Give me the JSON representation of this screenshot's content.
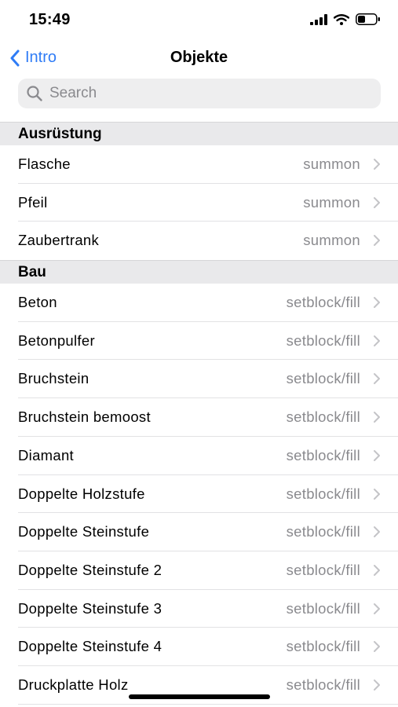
{
  "status_bar": {
    "time": "15:49"
  },
  "nav": {
    "back_label": "Intro",
    "title": "Objekte"
  },
  "search": {
    "placeholder": "Search"
  },
  "sections": [
    {
      "header": "Ausrüstung",
      "rows": [
        {
          "title": "Flasche",
          "detail": "summon"
        },
        {
          "title": "Pfeil",
          "detail": "summon"
        },
        {
          "title": "Zaubertrank",
          "detail": "summon"
        }
      ]
    },
    {
      "header": "Bau",
      "rows": [
        {
          "title": "Beton",
          "detail": "setblock/fill"
        },
        {
          "title": "Betonpulfer",
          "detail": "setblock/fill"
        },
        {
          "title": "Bruchstein",
          "detail": "setblock/fill"
        },
        {
          "title": "Bruchstein bemoost",
          "detail": "setblock/fill"
        },
        {
          "title": "Diamant",
          "detail": "setblock/fill"
        },
        {
          "title": "Doppelte Holzstufe",
          "detail": "setblock/fill"
        },
        {
          "title": "Doppelte Steinstufe",
          "detail": "setblock/fill"
        },
        {
          "title": "Doppelte Steinstufe 2",
          "detail": "setblock/fill"
        },
        {
          "title": "Doppelte Steinstufe 3",
          "detail": "setblock/fill"
        },
        {
          "title": "Doppelte Steinstufe 4",
          "detail": "setblock/fill"
        },
        {
          "title": "Druckplatte Holz",
          "detail": "setblock/fill"
        }
      ]
    }
  ],
  "colors": {
    "accent": "#2f7cf6",
    "secondary_text": "#8a8a8e",
    "section_bg": "#e9e9eb"
  },
  "icons": [
    "signal-icon",
    "wifi-icon",
    "battery-icon",
    "back-chevron-icon",
    "search-icon",
    "chevron-right-icon"
  ]
}
